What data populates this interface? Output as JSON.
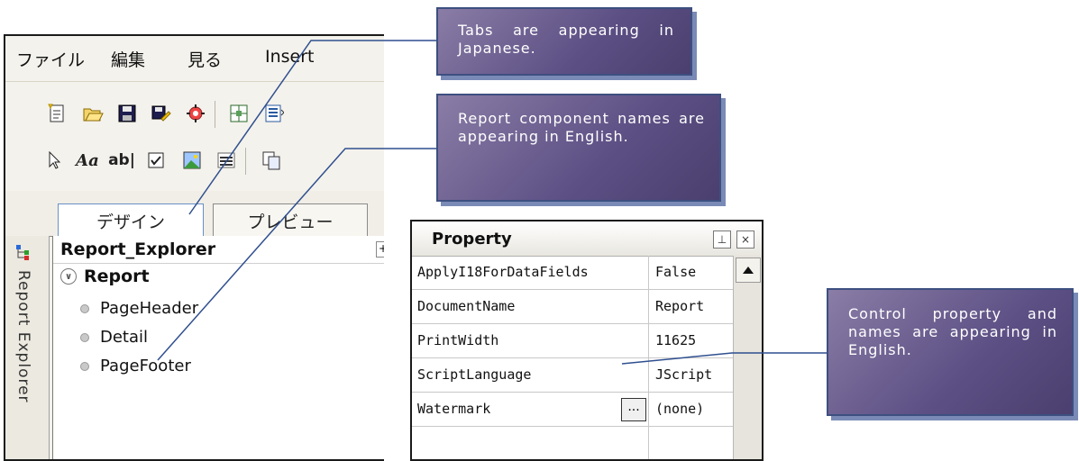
{
  "menu": [
    "ファイル",
    "編集",
    "見る",
    "Insert"
  ],
  "toolbar1": [
    "new-report-icon",
    "open-icon",
    "save-icon",
    "save-as-icon",
    "properties-icon",
    "grid-icon",
    "align-icon"
  ],
  "toolbar2": [
    "pointer-icon",
    "label-tool-icon",
    "textbox-tool-icon",
    "checkbox-tool-icon",
    "picture-tool-icon",
    "line-tool-icon",
    "copy-icon"
  ],
  "tabs": {
    "design": "デザイン",
    "preview": "プレビュー"
  },
  "sidebar": {
    "vertical_label": "Report Explorer"
  },
  "explorer": {
    "title": "Report_Explorer",
    "root": "Report",
    "items": [
      "PageHeader",
      "Detail",
      "PageFooter"
    ]
  },
  "property_grid": {
    "title": "Property",
    "rows": [
      {
        "name": "ApplyI18ForDataFields",
        "value": "False"
      },
      {
        "name": "DocumentName",
        "value": "Report"
      },
      {
        "name": "PrintWidth",
        "value": "11625"
      },
      {
        "name": "ScriptLanguage",
        "value": "JScript"
      },
      {
        "name": "Watermark",
        "value": "(none)"
      }
    ]
  },
  "callouts": {
    "tabs": "Tabs are appearing in Japanese.",
    "components": "Report component names are appearing in English.",
    "properties": "Control property and names are appearing in English."
  },
  "colors": {
    "callout_fill": "#5c4f84",
    "callout_border": "#3d4f80",
    "callout_shadow": "#7a8ab6",
    "connector": "#2f4f8f"
  }
}
